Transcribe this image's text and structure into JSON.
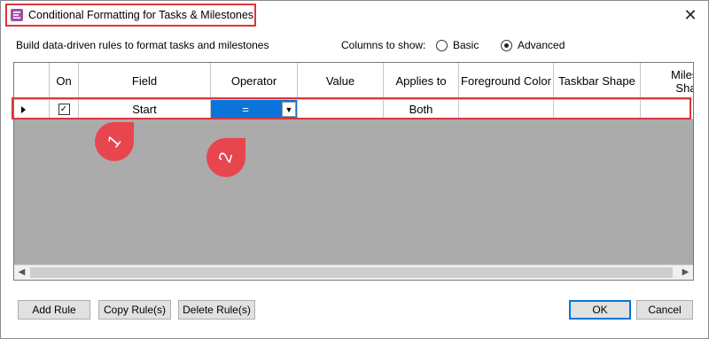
{
  "window": {
    "title": "Conditional Formatting for Tasks & Milestones",
    "close_glyph": "✕",
    "icon": "app-icon"
  },
  "description": "Build data-driven rules to format tasks and milestones",
  "columns_to_show": {
    "label": "Columns to show:",
    "options": [
      "Basic",
      "Advanced"
    ],
    "selected": "Advanced"
  },
  "grid": {
    "headers": [
      "",
      "On",
      "Field",
      "Operator",
      "Value",
      "Applies to",
      "Foreground Color",
      "Taskbar Shape",
      "Milest Sha"
    ],
    "rows": [
      {
        "on": true,
        "check_glyph": "✓",
        "field": "Start",
        "operator": "=",
        "value": "",
        "applies_to": "Both",
        "foreground_color": "",
        "taskbar_shape": "",
        "milestone_shape": ""
      }
    ],
    "selected_cell_color": "#0a74da"
  },
  "scrollbar": {
    "left_arrow": "◀",
    "right_arrow": "▶"
  },
  "markers": [
    "1",
    "2"
  ],
  "buttons": {
    "add_rule": "Add Rule",
    "copy_rules": "Copy Rule(s)",
    "delete_rules": "Delete Rule(s)",
    "ok": "OK",
    "cancel": "Cancel"
  },
  "colors": {
    "highlight": "#d9363e",
    "marker": "#e8464f",
    "grid_background": "#ababab"
  }
}
